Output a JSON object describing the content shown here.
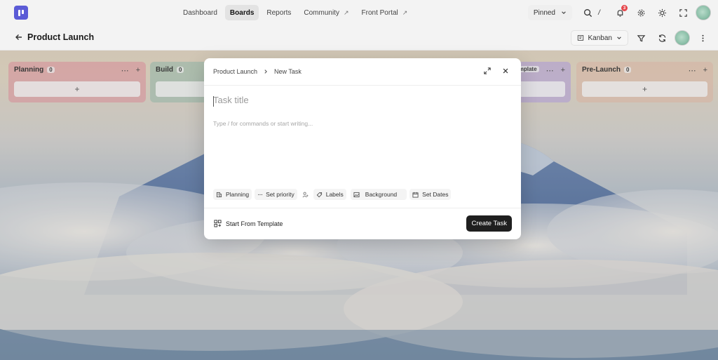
{
  "nav": {
    "items": [
      {
        "label": "Dashboard",
        "active": false,
        "external": false
      },
      {
        "label": "Boards",
        "active": true,
        "external": false
      },
      {
        "label": "Reports",
        "active": false,
        "external": false
      },
      {
        "label": "Community",
        "active": false,
        "external": true
      },
      {
        "label": "Front Portal",
        "active": false,
        "external": true
      }
    ],
    "pinned_label": "Pinned",
    "search_shortcut": "/",
    "notification_count": "3"
  },
  "subheader": {
    "title": "Product Launch",
    "view_label": "Kanban"
  },
  "columns": [
    {
      "name": "Planning",
      "count": "0",
      "color": "#e8a3a8"
    },
    {
      "name": "Build",
      "count": "0",
      "color": "#a9c7b5"
    },
    {
      "name": "Template",
      "count": "",
      "color": "#c4b2e0"
    },
    {
      "name": "Pre-Launch",
      "count": "0",
      "color": "#e9c7b3"
    }
  ],
  "modal": {
    "breadcrumb_project": "Product Launch",
    "breadcrumb_current": "New Task",
    "title_placeholder": "Task title",
    "description_placeholder": "Type / for commands or start writing...",
    "chips": {
      "status": "Planning",
      "priority": "Set priority",
      "labels": "Labels",
      "background": "Background",
      "dates": "Set Dates"
    },
    "template_label": "Start From Template",
    "create_label": "Create Task"
  },
  "colors": {
    "accent": "#5b5bd6",
    "primary_button": "#1f1f1f",
    "badge": "#e5484d"
  }
}
